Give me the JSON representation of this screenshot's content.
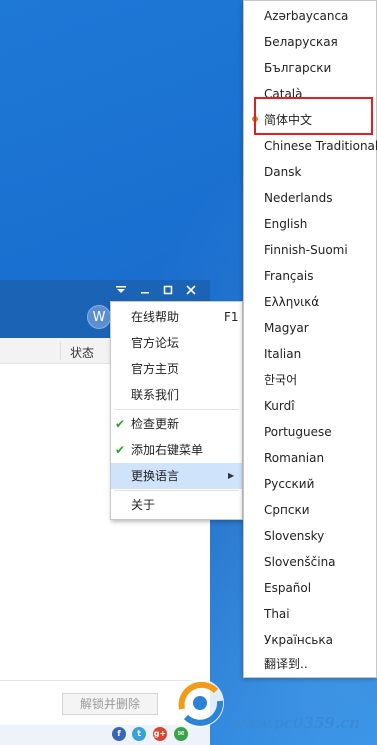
{
  "app": {
    "avatar_letter": "W",
    "column_status": "状态",
    "unlock_delete_label": "解锁并删除"
  },
  "context_menu": {
    "items": [
      {
        "label": "在线帮助",
        "shortcut": "F1"
      },
      {
        "label": "官方论坛"
      },
      {
        "label": "官方主页"
      },
      {
        "label": "联系我们"
      },
      {
        "label": "检查更新",
        "checked": true
      },
      {
        "label": "添加右键菜单",
        "checked": true
      },
      {
        "label": "更换语言",
        "has_submenu": true,
        "highlighted": true
      },
      {
        "label": "关于"
      }
    ]
  },
  "language_menu": {
    "selected": "简体中文",
    "items": [
      "Azərbaycanca",
      "Беларуская",
      "Български",
      "Català",
      "简体中文",
      "Chinese Traditional",
      "Dansk",
      "Nederlands",
      "English",
      "Finnish-Suomi",
      "Français",
      "Ελληνικά",
      "Magyar",
      "Italian",
      "한국어",
      "Kurdî",
      "Portuguese",
      "Romanian",
      "Русский",
      "Српски",
      "Slovensky",
      "Slovenščina",
      "Español",
      "Thai",
      "Українська",
      "翻译到.."
    ]
  },
  "watermark": {
    "site": "www.pc0359.cn"
  },
  "colors": {
    "desktop": "#1a6fcf",
    "titlebar": "#1b64b5",
    "highlight_box": "#e02020",
    "check": "#2aa52a",
    "menu_hover": "#cfe3fb"
  }
}
